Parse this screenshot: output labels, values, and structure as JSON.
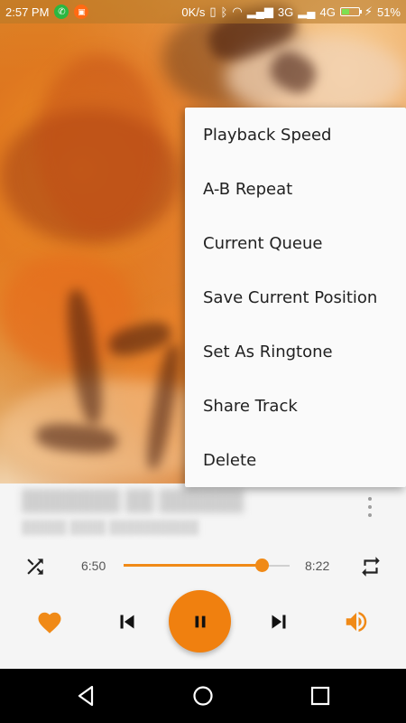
{
  "status_bar": {
    "time": "2:57 PM",
    "network_speed": "0K/s",
    "network_type_1": "3G",
    "network_type_2": "4G",
    "battery_percent": "51%",
    "battery_level": 0.51
  },
  "artwork": {
    "accent": "#e38b2e"
  },
  "player": {
    "elapsed": "6:50",
    "total": "8:22",
    "progress_fraction": 0.83,
    "accent_color": "#f08a17"
  },
  "menu": {
    "items": [
      {
        "label": "Playback Speed"
      },
      {
        "label": "A-B Repeat"
      },
      {
        "label": "Current Queue"
      },
      {
        "label": "Save Current Position"
      },
      {
        "label": "Set As Ringtone"
      },
      {
        "label": "Share Track"
      },
      {
        "label": "Delete"
      }
    ]
  },
  "icons": {
    "shuffle": "shuffle-icon",
    "repeat": "repeat-icon",
    "favorite": "heart-icon",
    "previous": "skip-previous-icon",
    "pause": "pause-icon",
    "next": "skip-next-icon",
    "volume": "volume-icon",
    "more": "more-vert-icon",
    "back": "back-icon",
    "home": "home-icon",
    "recents": "recents-icon"
  }
}
